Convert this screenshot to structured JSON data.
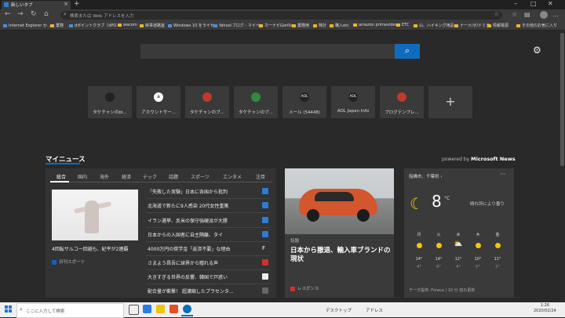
{
  "browser": {
    "tab_title": "新しいタブ",
    "new_tab_symbol": "+",
    "address_placeholder": "検索または Web アドレスを入力",
    "favorites": [
      "Internet Explorer か...",
      "業務",
      "dポイントクラブ（dPO...",
      "wacom",
      "映事道路室",
      "Windows 10 をライセ...",
      "Yahoo!ブログ - マイペ...",
      "カーナビGorilla",
      "業務用",
      "特計",
      "職入etc",
      "amazon primevideo",
      "ETC",
      "山、ハイキング用品",
      "ナーメ/ボ/ドミタ",
      "情報電源"
    ],
    "favorites_other": "その他のお気に入り"
  },
  "search": {
    "button_icon": "search-icon"
  },
  "tiles": [
    {
      "label": "タケチャンのbl...",
      "logo": ""
    },
    {
      "label": "アカウントサー...",
      "logo": "a"
    },
    {
      "label": "タケチャンのブ...",
      "logo": ""
    },
    {
      "label": "タケチャンのブ...",
      "logo": ""
    },
    {
      "label": "メール (54448)",
      "logo": "AOL"
    },
    {
      "label": "AOL Japan Info",
      "logo": "AOL"
    },
    {
      "label": "ブログテンプレ...",
      "logo": ""
    }
  ],
  "tile_add_symbol": "+",
  "news": {
    "title": "マイニュース",
    "powered_prefix": "powered by",
    "powered_brand": "Microsoft News",
    "tabs": [
      "総合",
      "国内",
      "海外",
      "経済",
      "テック",
      "話題",
      "スポーツ",
      "エンタメ",
      "注目"
    ],
    "featured": {
      "title": "4回転サルコー回避も、紀平が2連覇",
      "source": "日刊スポーツ"
    },
    "headlines": [
      "「失敗した実験」日本に各国から批判",
      "北海道で新たに9人感染 20代女性重篤",
      "イラン選挙、反米の保守強硬派が大勝",
      "日本からの入国者に自主隔離、タイ",
      "4000万円の奨学金「返済不要」な理由",
      "さまよう昌吾に球界から贈れる声",
      "大きすぎる世界の反響、韓国で戸惑い",
      "配合量が衝撃！ 超濃縮したプラセンタ..."
    ]
  },
  "middle_card": {
    "tag": "話題",
    "title": "日本から撤退、輸入車ブランドの現状",
    "source": "レスポンス"
  },
  "weather": {
    "location": "船橋市、千葉県",
    "temp": "8",
    "unit": "°C",
    "desc": "晴れ所により曇り",
    "days": [
      {
        "day": "月",
        "hi": "14°",
        "lo": "4°"
      },
      {
        "day": "火",
        "hi": "14°",
        "lo": "6°"
      },
      {
        "day": "水",
        "hi": "12°",
        "lo": "4°"
      },
      {
        "day": "木",
        "hi": "10°",
        "lo": "0°"
      },
      {
        "day": "金",
        "hi": "11°",
        "lo": "2°"
      }
    ],
    "footer": "データ提供: Foreca | 10 分 前の更新"
  },
  "taskbar": {
    "search_placeholder": "ここに入力して検索",
    "desktop_label": "デスクトップ",
    "address_label": "アドレス",
    "time": "1:26",
    "date": "2020/02/24"
  },
  "colors": {
    "accent": "#0f6cbd",
    "background": "#292929",
    "card": "#3a3a3a"
  }
}
